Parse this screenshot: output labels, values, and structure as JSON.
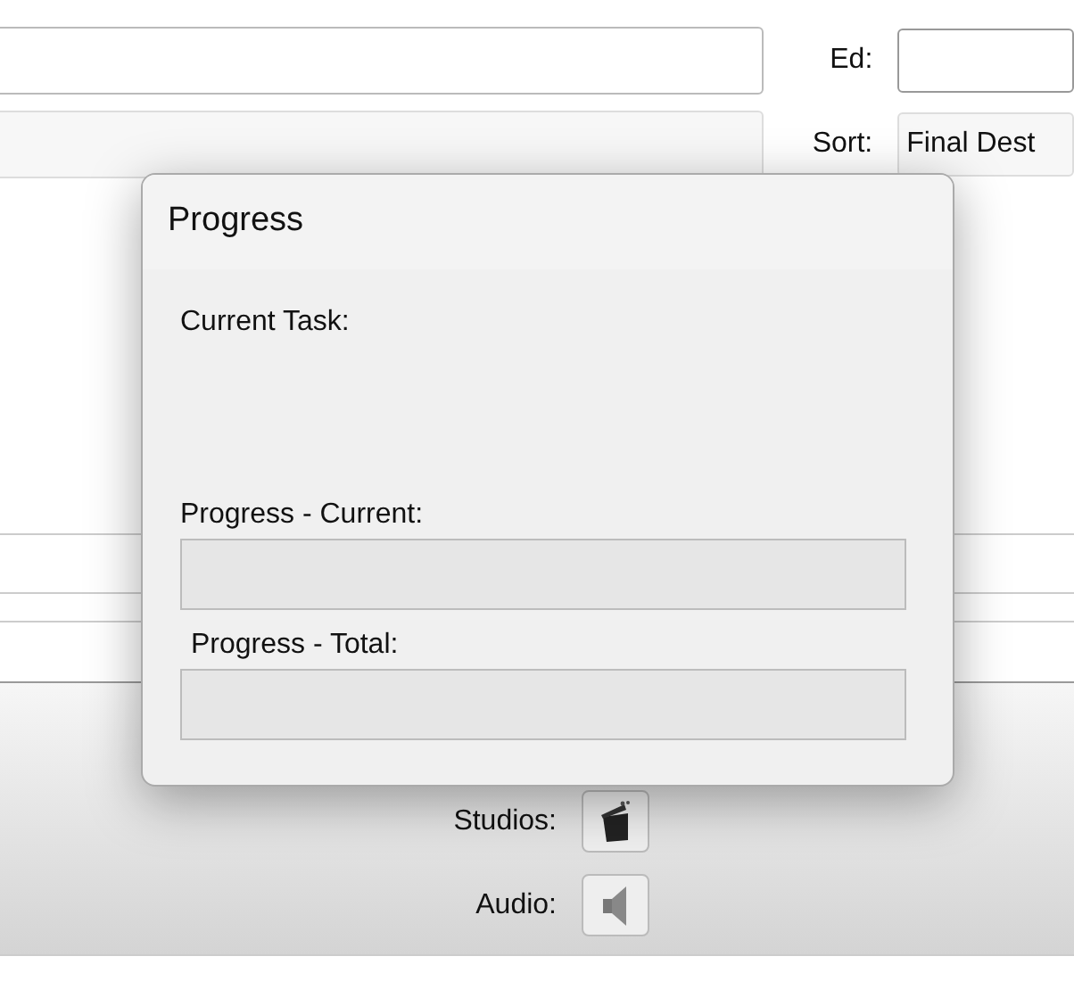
{
  "background": {
    "ed": {
      "label": "Ed:"
    },
    "sort": {
      "label": "Sort:",
      "value": "Final Dest"
    },
    "buttons": [
      {
        "label": "Studios:",
        "kind": "clapper"
      },
      {
        "label": "Audio:",
        "kind": "speaker"
      }
    ]
  },
  "dialog": {
    "title": "Progress",
    "current_task_label": "Current Task:",
    "bars": [
      {
        "label": "Progress - Current:",
        "level": 0
      },
      {
        "label": "Progress - Total:",
        "level": 0
      }
    ]
  }
}
